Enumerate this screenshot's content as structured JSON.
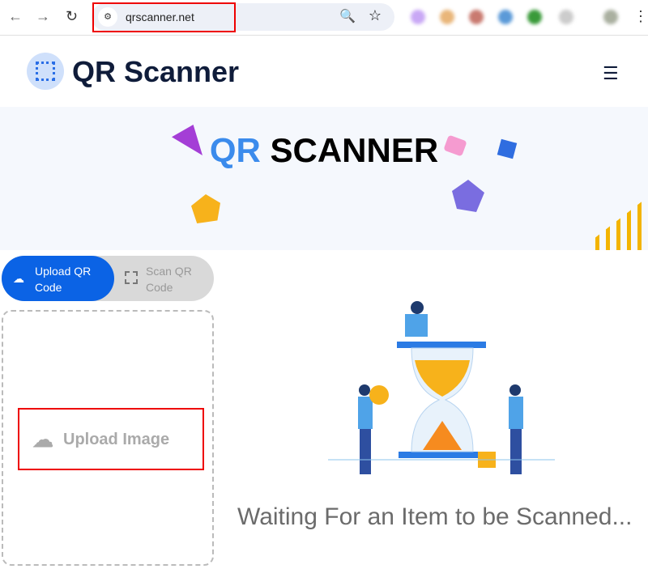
{
  "browser": {
    "url": "qrscanner.net",
    "back_icon": "arrow-left-icon",
    "forward_icon": "arrow-right-icon",
    "reload_icon": "reload-icon"
  },
  "header": {
    "brand": "QR Scanner"
  },
  "hero": {
    "title_accent": "QR",
    "title_main": "SCANNER"
  },
  "tabs": [
    {
      "label": "Upload QR Code",
      "active": true
    },
    {
      "label": "Scan QR Code",
      "active": false
    }
  ],
  "upload": {
    "label": "Upload Image"
  },
  "status": {
    "text": "Waiting For an Item to be Scanned..."
  },
  "colors": {
    "accent": "#0b63e5",
    "hero_accent": "#3b8bec",
    "highlight": "#ee0000"
  }
}
